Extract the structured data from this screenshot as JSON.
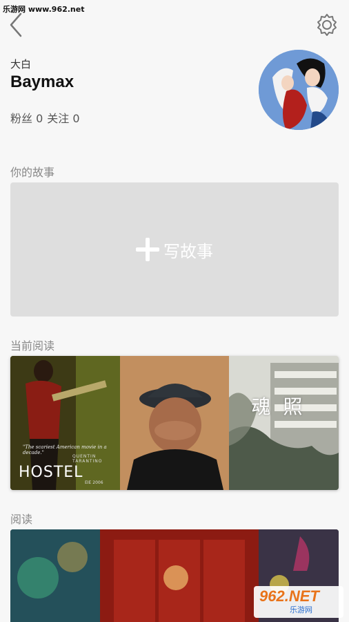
{
  "watermark": {
    "top_text": "乐游网 www.962.net",
    "bottom_main": "962.NET",
    "bottom_sub": "乐游网"
  },
  "header": {
    "back_icon": "chevron-left-icon",
    "settings_icon": "gear-icon"
  },
  "profile": {
    "nickname": "大白",
    "username": "Baymax",
    "fans_label": "粉丝",
    "fans_count": "0",
    "following_label": "关注",
    "following_count": "0"
  },
  "sections": {
    "your_stories": "你的故事",
    "currently_reading": "当前阅读",
    "read": "阅读"
  },
  "write_story": {
    "label": "写故事",
    "icon": "plus-icon"
  },
  "current_books": [
    {
      "title": "HOSTEL",
      "tagline": "\"The scariest American movie in a decade.\"",
      "presenter": "QUENTIN TARANTINO",
      "date": "EIE 2006"
    },
    {
      "title": ""
    },
    {
      "title": "魂照"
    }
  ],
  "colors": {
    "background": "#f7f7f7",
    "card_gray": "#dedede",
    "section_text": "#888888",
    "accent_orange": "#e8731a",
    "accent_blue": "#2b6fd0"
  }
}
